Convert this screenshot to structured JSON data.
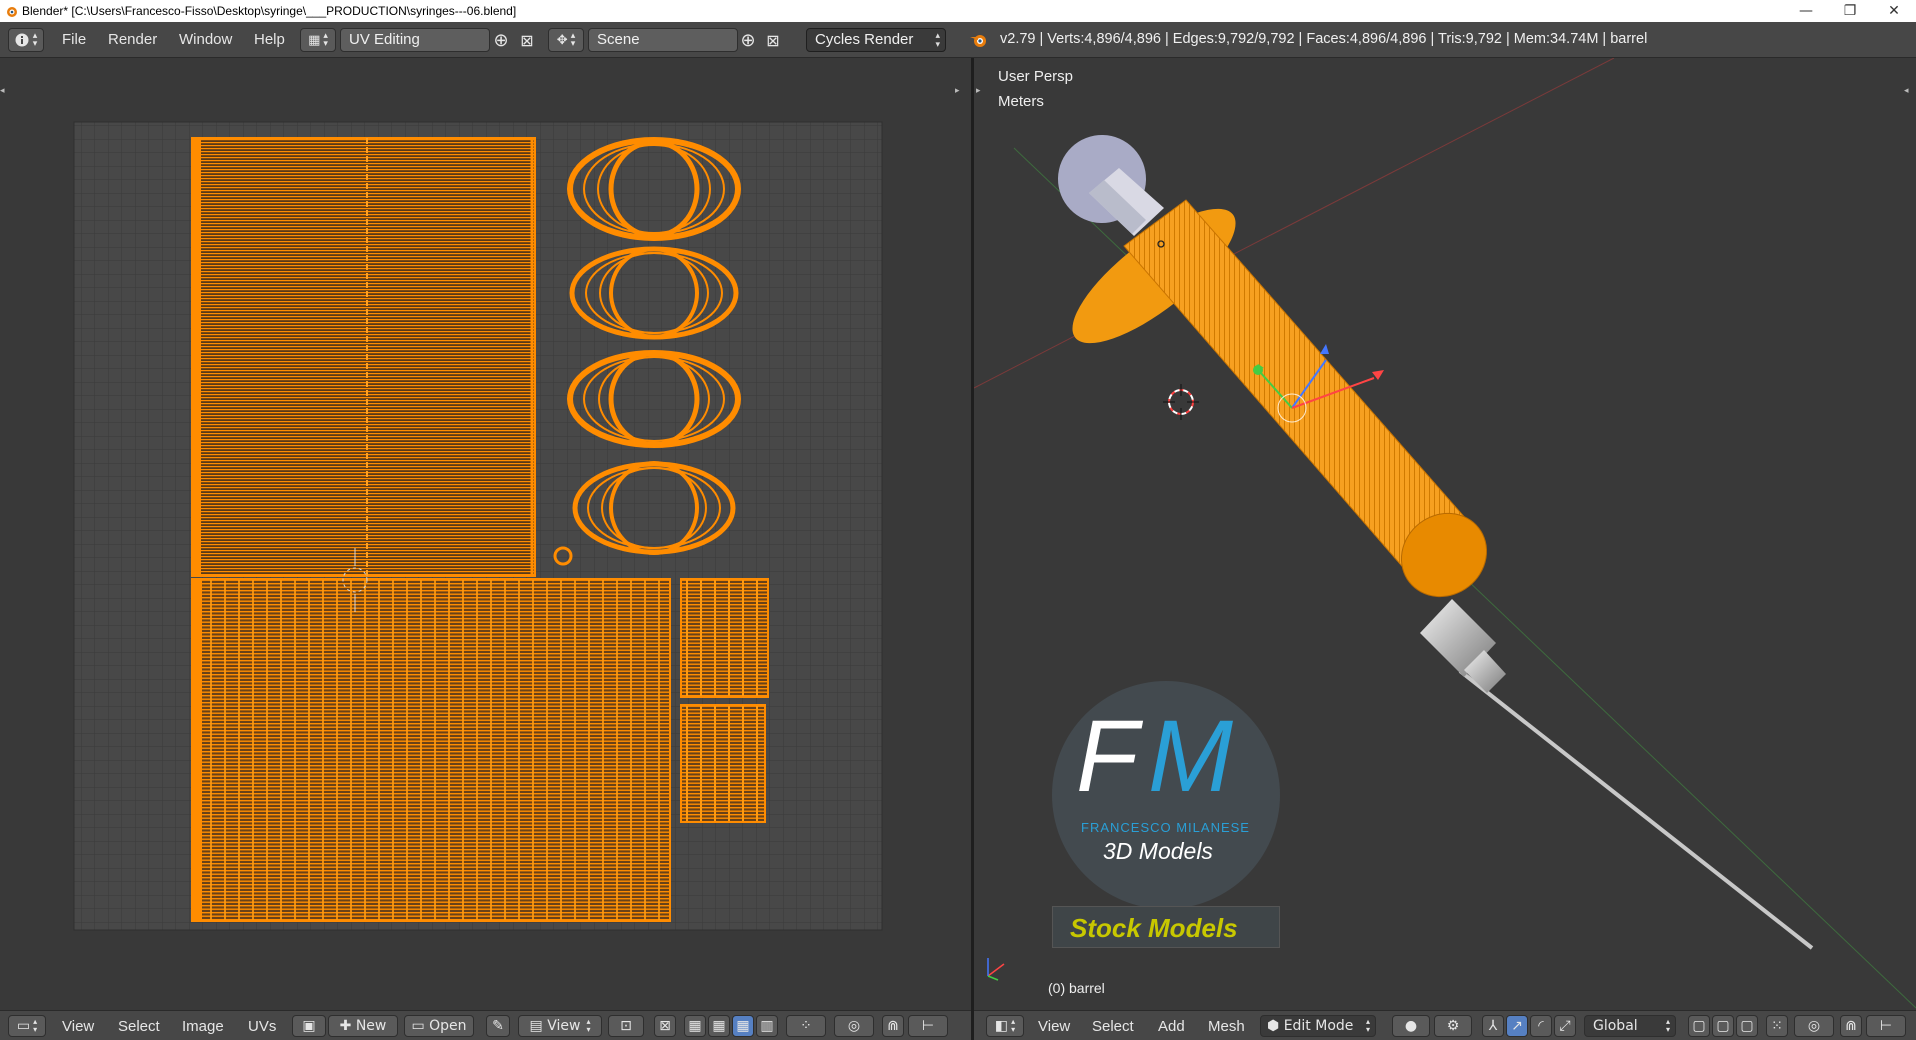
{
  "window": {
    "title": "Blender* [C:\\Users\\Francesco-Fisso\\Desktop\\syringe\\___PRODUCTION\\syringes---06.blend]",
    "minimize": "—",
    "restore": "❐",
    "close": "✕"
  },
  "info_header": {
    "menus": [
      "File",
      "Render",
      "Window",
      "Help"
    ],
    "screen_layout": "UV Editing",
    "scene": "Scene",
    "render_engine": "Cycles Render",
    "stats": "v2.79 | Verts:4,896/4,896 | Edges:9,792/9,792 | Faces:4,896/4,896 | Tris:9,792 | Mem:34.74M | barrel"
  },
  "uv_editor": {
    "menus": [
      "View",
      "Select",
      "Image",
      "UVs"
    ],
    "new_label": "New",
    "open_label": "Open",
    "view_label": "View"
  },
  "viewport": {
    "perspective_label": "User Persp",
    "units_label": "Meters",
    "object_label": "(0) barrel",
    "menus": [
      "View",
      "Select",
      "Add",
      "Mesh"
    ],
    "mode": "Edit Mode",
    "orientation": "Global",
    "watermark": {
      "initials_f": "F",
      "initials_m": "M",
      "name": "FRANCESCO MILANESE",
      "subtitle": "3D Models",
      "banner": "Stock Models"
    }
  },
  "colors": {
    "uv_orange": "#ff8c00",
    "mesh_orange": "#f7a020",
    "accent_blue": "#5680c2",
    "watermark_blue": "#2a9fd6",
    "banner_yellow": "#c8c800"
  }
}
